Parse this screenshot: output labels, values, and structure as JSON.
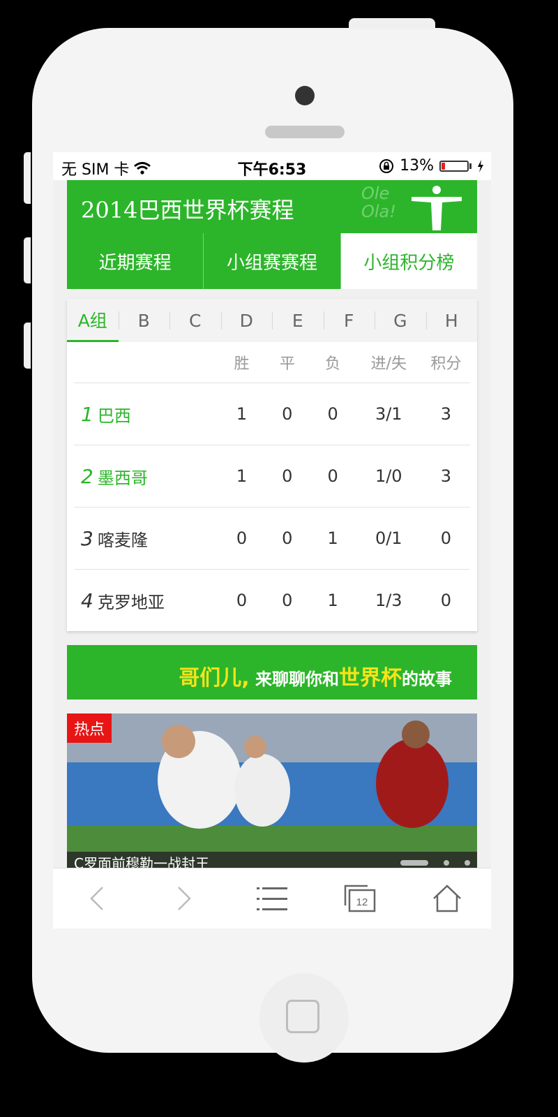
{
  "status_bar": {
    "carrier": "无 SIM 卡",
    "time": "下午6:53",
    "battery": "13%",
    "battery_level": 0.13
  },
  "header": {
    "title": "2014巴西世界杯赛程",
    "deco_text_1": "Ole",
    "deco_text_2": "Ola!"
  },
  "tabs": [
    {
      "label": "近期赛程",
      "active": false
    },
    {
      "label": "小组赛赛程",
      "active": false
    },
    {
      "label": "小组积分榜",
      "active": true
    }
  ],
  "groups": [
    "A组",
    "B",
    "C",
    "D",
    "E",
    "F",
    "G",
    "H"
  ],
  "standings": {
    "headers": {
      "win": "胜",
      "draw": "平",
      "loss": "负",
      "goals": "进/失",
      "points": "积分"
    },
    "rows": [
      {
        "rank": "1",
        "team": "巴西",
        "win": "1",
        "draw": "0",
        "loss": "0",
        "goals": "3/1",
        "points": "3"
      },
      {
        "rank": "2",
        "team": "墨西哥",
        "win": "1",
        "draw": "0",
        "loss": "0",
        "goals": "1/0",
        "points": "3"
      },
      {
        "rank": "3",
        "team": "喀麦隆",
        "win": "0",
        "draw": "0",
        "loss": "1",
        "goals": "0/1",
        "points": "0"
      },
      {
        "rank": "4",
        "team": "克罗地亚",
        "win": "0",
        "draw": "0",
        "loss": "1",
        "goals": "1/3",
        "points": "0"
      }
    ]
  },
  "banner": {
    "part1": "哥们儿,",
    "part2": " 来聊聊你和",
    "part3": "世界杯",
    "part4": "的故事"
  },
  "news": {
    "tag": "热点",
    "caption": "C罗面前穆勒一战封王"
  },
  "bottom_bar": {
    "tabs_count": "12"
  },
  "colors": {
    "accent": "#2cb52a",
    "hot": "#e81515"
  }
}
